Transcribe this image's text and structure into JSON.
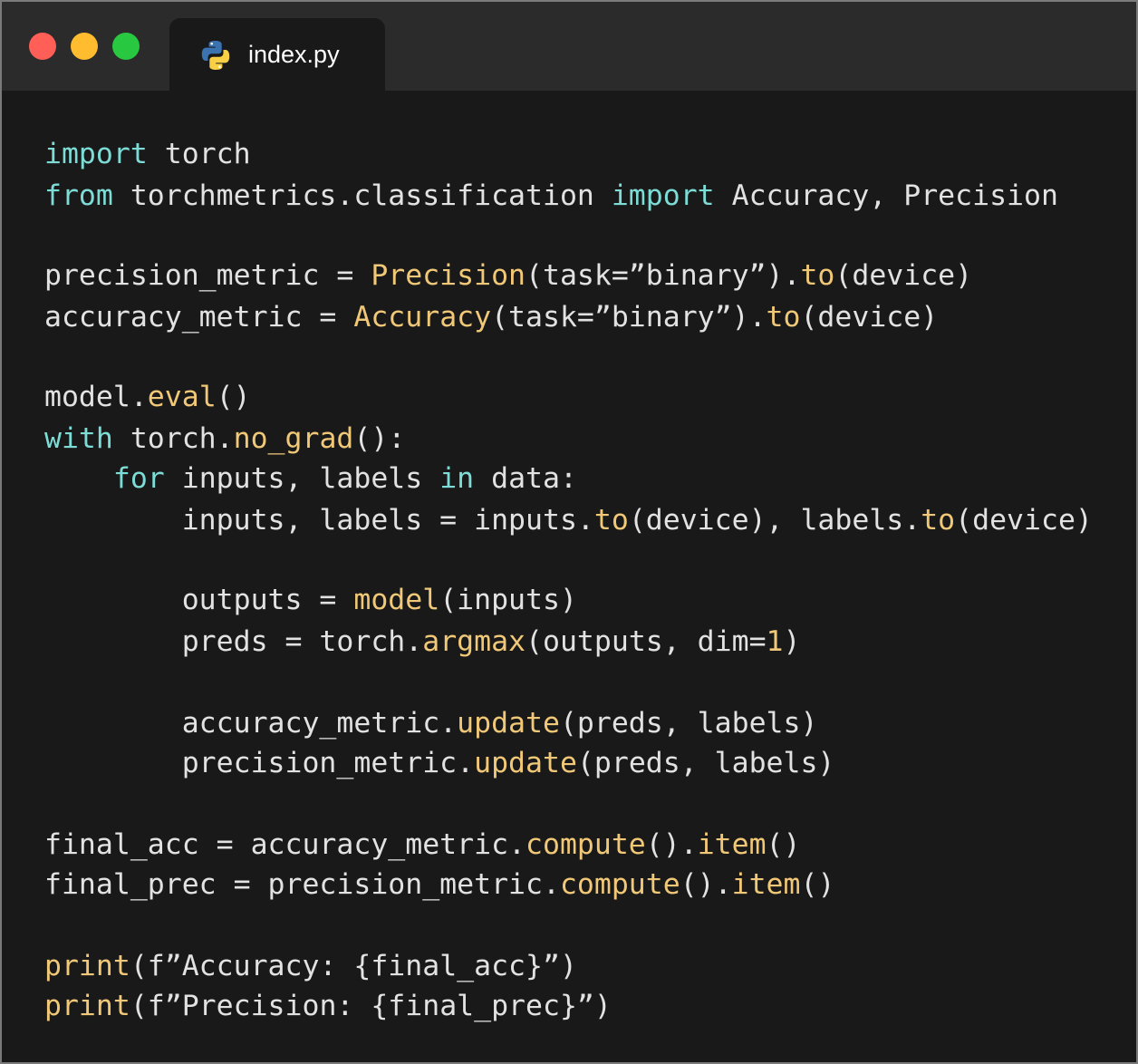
{
  "window": {
    "colors": {
      "close": "#ff5f57",
      "minimize": "#febc2e",
      "maximize": "#28c840",
      "background": "#191919",
      "titlebar": "#2b2b2b",
      "keyword": "#7ddcd6",
      "function": "#f0c877",
      "text": "#e2e2e2"
    }
  },
  "tab": {
    "icon": "python-icon",
    "label": "index.py"
  },
  "code": {
    "lines": [
      [
        {
          "t": "import",
          "c": "kw"
        },
        {
          "t": " torch",
          "c": ""
        }
      ],
      [
        {
          "t": "from",
          "c": "kw"
        },
        {
          "t": " torchmetrics.classification ",
          "c": ""
        },
        {
          "t": "import",
          "c": "kw"
        },
        {
          "t": " Accuracy, Precision",
          "c": ""
        }
      ],
      [
        {
          "t": "precision_metric = ",
          "c": ""
        },
        {
          "t": "Precision",
          "c": "fn"
        },
        {
          "t": "(task=”binary”).",
          "c": ""
        },
        {
          "t": "to",
          "c": "fn"
        },
        {
          "t": "(device)",
          "c": ""
        }
      ],
      [
        {
          "t": "accuracy_metric = ",
          "c": ""
        },
        {
          "t": "Accuracy",
          "c": "fn"
        },
        {
          "t": "(task=”binary”).",
          "c": ""
        },
        {
          "t": "to",
          "c": "fn"
        },
        {
          "t": "(device)",
          "c": ""
        }
      ],
      [
        {
          "t": "model.",
          "c": ""
        },
        {
          "t": "eval",
          "c": "fn"
        },
        {
          "t": "()",
          "c": ""
        }
      ],
      [
        {
          "t": "with",
          "c": "kw"
        },
        {
          "t": " torch.",
          "c": ""
        },
        {
          "t": "no_grad",
          "c": "fn"
        },
        {
          "t": "():",
          "c": ""
        }
      ],
      [
        {
          "t": "    ",
          "c": ""
        },
        {
          "t": "for",
          "c": "kw"
        },
        {
          "t": " inputs, labels ",
          "c": ""
        },
        {
          "t": "in",
          "c": "kw"
        },
        {
          "t": " data:",
          "c": ""
        }
      ],
      [
        {
          "t": "        inputs, labels = inputs.",
          "c": ""
        },
        {
          "t": "to",
          "c": "fn"
        },
        {
          "t": "(device), labels.",
          "c": ""
        },
        {
          "t": "to",
          "c": "fn"
        },
        {
          "t": "(device)",
          "c": ""
        }
      ],
      [
        {
          "t": "        outputs = ",
          "c": ""
        },
        {
          "t": "model",
          "c": "fn"
        },
        {
          "t": "(inputs)",
          "c": ""
        }
      ],
      [
        {
          "t": "        preds = torch.",
          "c": ""
        },
        {
          "t": "argmax",
          "c": "fn"
        },
        {
          "t": "(outputs, dim=",
          "c": ""
        },
        {
          "t": "1",
          "c": "fn"
        },
        {
          "t": ")",
          "c": ""
        }
      ],
      [
        {
          "t": "        accuracy_metric.",
          "c": ""
        },
        {
          "t": "update",
          "c": "fn"
        },
        {
          "t": "(preds, labels)",
          "c": ""
        }
      ],
      [
        {
          "t": "        precision_metric.",
          "c": ""
        },
        {
          "t": "update",
          "c": "fn"
        },
        {
          "t": "(preds, labels)",
          "c": ""
        }
      ],
      [
        {
          "t": "final_acc = accuracy_metric.",
          "c": ""
        },
        {
          "t": "compute",
          "c": "fn"
        },
        {
          "t": "().",
          "c": ""
        },
        {
          "t": "item",
          "c": "fn"
        },
        {
          "t": "()",
          "c": ""
        }
      ],
      [
        {
          "t": "final_prec = precision_metric.",
          "c": ""
        },
        {
          "t": "compute",
          "c": "fn"
        },
        {
          "t": "().",
          "c": ""
        },
        {
          "t": "item",
          "c": "fn"
        },
        {
          "t": "()",
          "c": ""
        }
      ],
      [
        {
          "t": "print",
          "c": "fn"
        },
        {
          "t": "(f”Accuracy: {final_acc}”)",
          "c": ""
        }
      ],
      [
        {
          "t": "print",
          "c": "fn"
        },
        {
          "t": "(f”Precision: {final_prec}”)",
          "c": ""
        }
      ]
    ]
  }
}
